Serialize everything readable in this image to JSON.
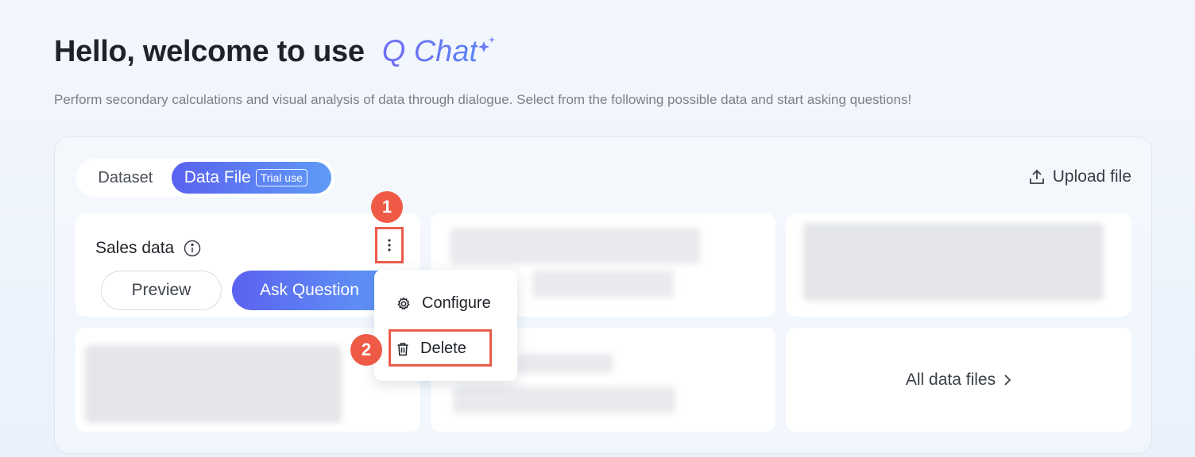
{
  "header": {
    "title": "Hello, welcome to use",
    "brand": "Q Chat",
    "subtitle": "Perform secondary calculations and visual analysis of data through dialogue. Select from the following possible data and start asking questions!"
  },
  "tabs": {
    "dataset": "Dataset",
    "data_file": "Data File",
    "trial_badge": "Trial use"
  },
  "upload_label": "Upload file",
  "card": {
    "title": "Sales data",
    "preview": "Preview",
    "ask": "Ask Question"
  },
  "menu": {
    "configure": "Configure",
    "delete": "Delete"
  },
  "callouts": [
    "1",
    "2"
  ],
  "all_files": "All data files",
  "colors": {
    "accent_start": "#5a62f0",
    "accent_end": "#5f9bf6",
    "callout": "#ee5a45"
  },
  "icons": [
    "sparkle-icon",
    "upload-icon",
    "info-icon",
    "more-vertical-icon",
    "gear-icon",
    "trash-icon",
    "chevron-right-icon"
  ]
}
